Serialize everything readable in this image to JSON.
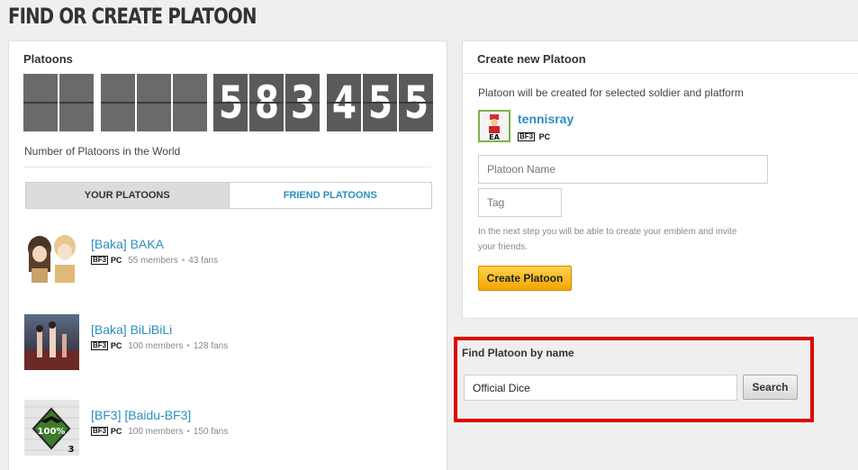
{
  "page": {
    "title": "FIND OR CREATE PLATOON"
  },
  "platoons_panel": {
    "title": "Platoons",
    "counter_digits": [
      "",
      "",
      "",
      "",
      "",
      "5",
      "8",
      "3",
      "4",
      "5",
      "5"
    ],
    "counter_caption": "Number of Platoons in the World",
    "tabs": [
      {
        "label": "YOUR PLATOONS",
        "active": true
      },
      {
        "label": "FRIEND PLATOONS",
        "active": false
      }
    ],
    "platoons": [
      {
        "name": "[Baka] BAKA",
        "game": "BF3",
        "platform": "PC",
        "members": "55 members",
        "fans": "43 fans"
      },
      {
        "name": "[Baka] BiLiBiLi",
        "game": "BF3",
        "platform": "PC",
        "members": "100 members",
        "fans": "128 fans"
      },
      {
        "name": "[BF3] [Baidu-BF3]",
        "game": "BF3",
        "platform": "PC",
        "members": "100 members",
        "fans": "150 fans",
        "emblem_text": "100%",
        "emblem_badge": "3"
      }
    ]
  },
  "create_panel": {
    "title": "Create new Platoon",
    "intro": "Platoon will be created for selected soldier and platform",
    "soldier": {
      "name": "tennisray",
      "game": "BF3",
      "platform": "PC",
      "icon_text": "EA"
    },
    "name_placeholder": "Platoon Name",
    "tag_placeholder": "Tag",
    "hint_line1": "In the next step you will be able to create your emblem and invite",
    "hint_line2": "your friends.",
    "create_label": "Create Platoon"
  },
  "find_panel": {
    "title": "Find Platoon by name",
    "search_value": "Official Dice",
    "search_label": "Search"
  },
  "colors": {
    "link": "#2b8fbf",
    "highlight_border": "#e00000",
    "button_orange": "#f4a400"
  }
}
